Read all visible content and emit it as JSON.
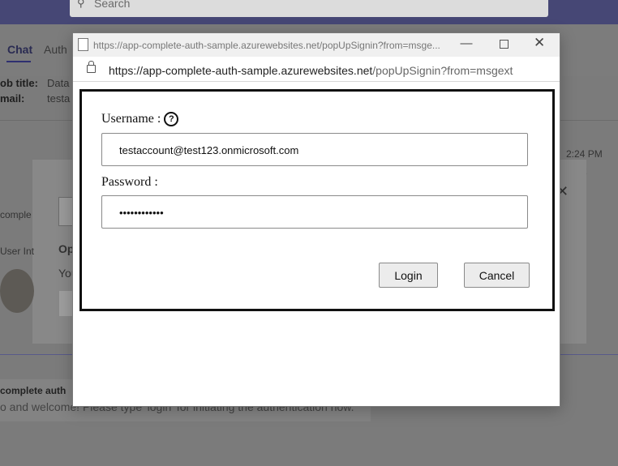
{
  "background": {
    "search_placeholder": "Search",
    "tabs": {
      "chat": "Chat",
      "auth": "Auth"
    },
    "info": [
      {
        "label": "ob title:",
        "value": "Data"
      },
      {
        "label": "mail:",
        "value": "testa"
      }
    ],
    "message_time": "2:24 PM",
    "message_snippet": "ebook",
    "side_labels": [
      "comple",
      "User Int"
    ],
    "dialog_texts": [
      "Op",
      "You"
    ],
    "bot_name": "complete auth",
    "bot_message": "o and welcome! Please type 'login' for initiating the authentication now."
  },
  "popup": {
    "window_title": "https://app-complete-auth-sample.azurewebsites.net/popUpSignin?from=msge...",
    "url_domain": "https://app-complete-auth-sample.azurewebsites.net",
    "url_path": "/popUpSignin?from=msgext",
    "icons": {
      "minimize": "minimize-icon",
      "maximize": "maximize-icon",
      "close": "close-icon",
      "lock": "lock-icon",
      "help": "help-icon"
    },
    "form": {
      "username_label": "Username :",
      "help_glyph": "?",
      "username_value": "testaccount@test123.onmicrosoft.com",
      "password_label": "Password :",
      "password_value": "••••••••••••",
      "login_label": "Login",
      "cancel_label": "Cancel"
    }
  }
}
